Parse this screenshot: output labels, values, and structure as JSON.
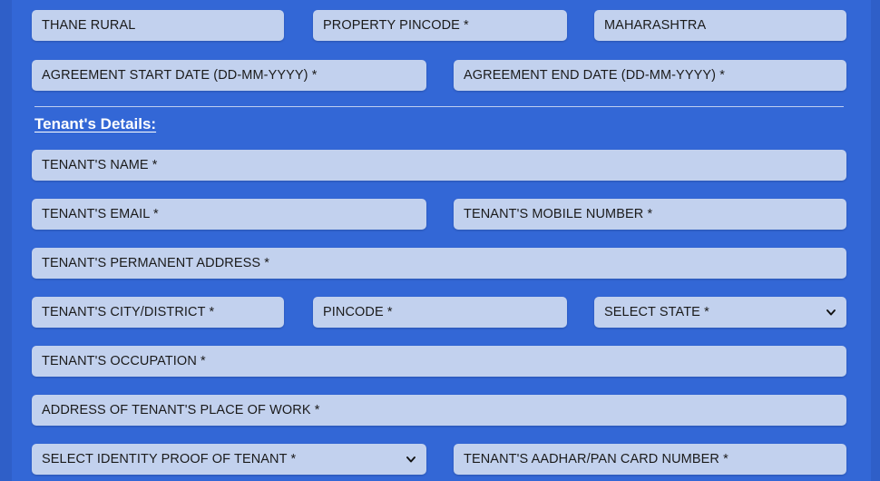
{
  "theme": {
    "background": "#3367d6",
    "edge_strip": "#2f5fc8",
    "field_background": "#c2d1ee",
    "field_text": "#1b1b1b",
    "heading_text": "#ffffff",
    "divider": "#d8e2f5"
  },
  "section": {
    "title": "Tenant's Details:"
  },
  "icons": {
    "dropdown": "chevron-down-icon"
  },
  "rows": [
    {
      "id": "property-location-row",
      "fields": [
        {
          "name": "property-city-district-field",
          "type": "text",
          "value": "THANE RURAL",
          "required": false
        },
        {
          "name": "property-pincode-field",
          "type": "text",
          "value": "PROPERTY PINCODE *",
          "required": true
        },
        {
          "name": "property-state-field",
          "type": "text",
          "value": "MAHARASHTRA",
          "required": false
        }
      ]
    },
    {
      "id": "agreement-dates-row",
      "fields": [
        {
          "name": "agreement-start-date-field",
          "type": "text",
          "value": "AGREEMENT START DATE (DD-MM-YYYY) *",
          "required": true
        },
        {
          "name": "agreement-end-date-field",
          "type": "text",
          "value": "AGREEMENT END DATE (DD-MM-YYYY) *",
          "required": true
        }
      ]
    },
    {
      "id": "tenant-name-row",
      "fields": [
        {
          "name": "tenant-name-field",
          "type": "text",
          "value": "TENANT'S NAME *",
          "required": true
        }
      ]
    },
    {
      "id": "tenant-contact-row",
      "fields": [
        {
          "name": "tenant-email-field",
          "type": "text",
          "value": "TENANT'S EMAIL *",
          "required": true
        },
        {
          "name": "tenant-mobile-field",
          "type": "text",
          "value": "TENANT'S MOBILE NUMBER *",
          "required": true
        }
      ]
    },
    {
      "id": "tenant-permanent-address-row",
      "fields": [
        {
          "name": "tenant-permanent-address-field",
          "type": "text",
          "value": "TENANT'S PERMANENT ADDRESS *",
          "required": true
        }
      ]
    },
    {
      "id": "tenant-location-row",
      "fields": [
        {
          "name": "tenant-city-district-field",
          "type": "text",
          "value": "TENANT'S CITY/DISTRICT *",
          "required": true
        },
        {
          "name": "tenant-pincode-field",
          "type": "text",
          "value": "PINCODE *",
          "required": true
        },
        {
          "name": "tenant-state-select",
          "type": "select",
          "value": "SELECT STATE *",
          "required": true
        }
      ]
    },
    {
      "id": "tenant-occupation-row",
      "fields": [
        {
          "name": "tenant-occupation-field",
          "type": "text",
          "value": "TENANT'S OCCUPATION *",
          "required": true
        }
      ]
    },
    {
      "id": "tenant-work-address-row",
      "fields": [
        {
          "name": "tenant-work-address-field",
          "type": "text",
          "value": "ADDRESS OF TENANT'S PLACE OF WORK *",
          "required": true
        }
      ]
    },
    {
      "id": "tenant-identity-row",
      "fields": [
        {
          "name": "tenant-identity-proof-select",
          "type": "select",
          "value": "SELECT IDENTITY PROOF OF TENANT *",
          "required": true
        },
        {
          "name": "tenant-aadhar-pan-field",
          "type": "text",
          "value": "TENANT'S AADHAR/PAN CARD NUMBER *",
          "required": true
        }
      ]
    }
  ]
}
